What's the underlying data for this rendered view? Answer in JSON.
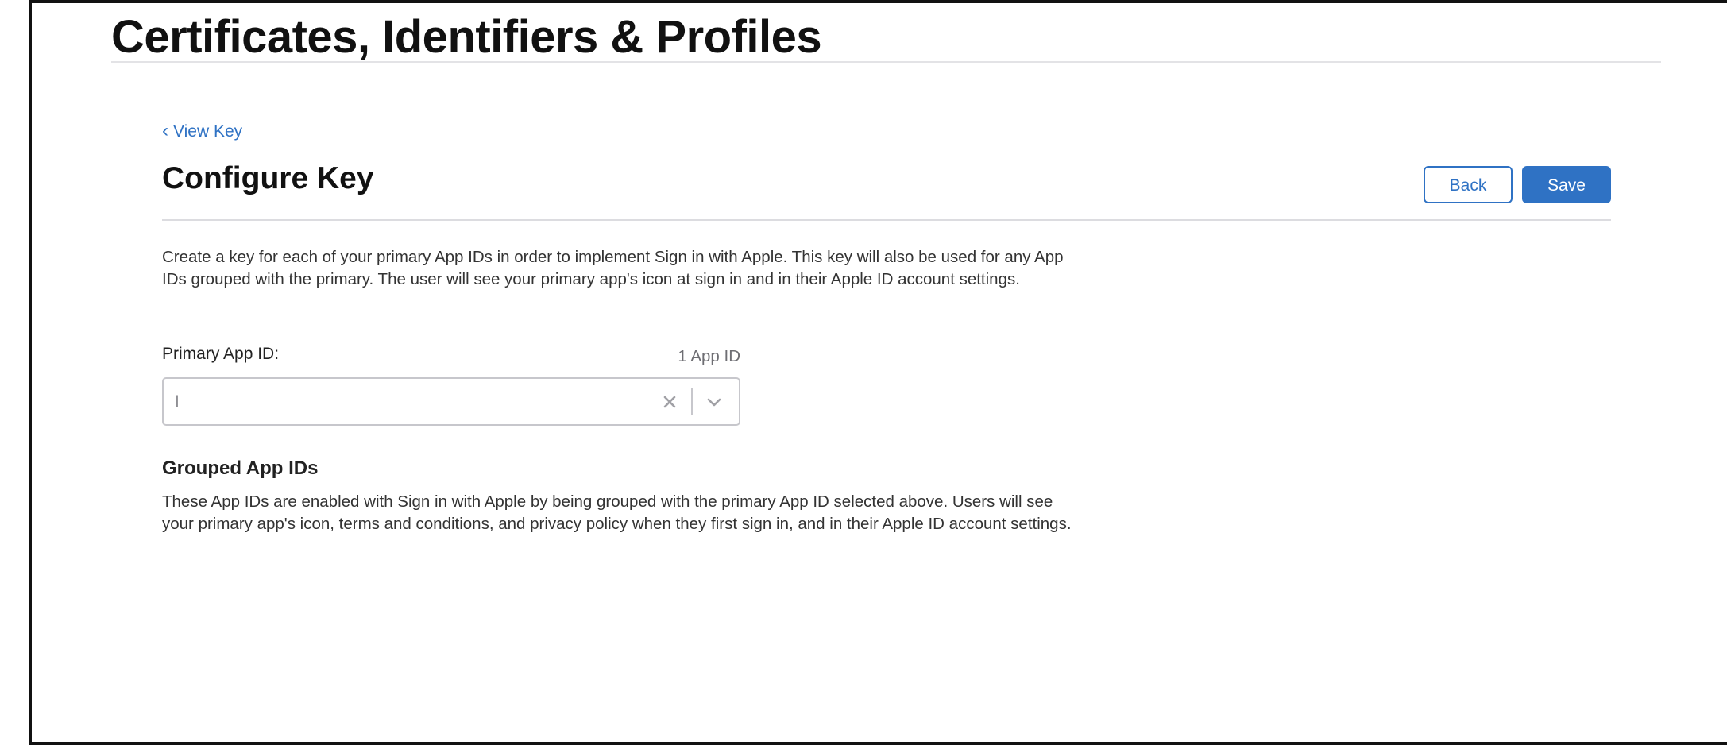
{
  "header": {
    "site_title": "Certificates, Identifiers & Profiles"
  },
  "nav": {
    "back_link_chevron": "‹",
    "back_link_label": "View Key"
  },
  "page": {
    "title": "Configure Key",
    "back_button": "Back",
    "save_button": "Save",
    "intro": "Create a key for each of your primary App IDs in order to implement Sign in with Apple. This key will also be used for any App IDs grouped with the primary. The user will see your primary app's icon at sign in and in their Apple ID account settings."
  },
  "primary_app_id": {
    "label": "Primary App ID:",
    "count": "1 App ID",
    "value": "I",
    "clear_icon": "close-x-icon",
    "dropdown_icon": "chevron-down-icon"
  },
  "grouped": {
    "heading": "Grouped App IDs",
    "description": "These App IDs are enabled with Sign in with Apple by being grouped with the primary App ID selected above. Users will see your primary app's icon, terms and conditions, and privacy policy when they first sign in, and in their Apple ID account settings."
  },
  "colors": {
    "accent": "#2f72c4",
    "text": "#1d1d1f",
    "muted": "#6e6e73",
    "border": "#c7c7cc"
  }
}
